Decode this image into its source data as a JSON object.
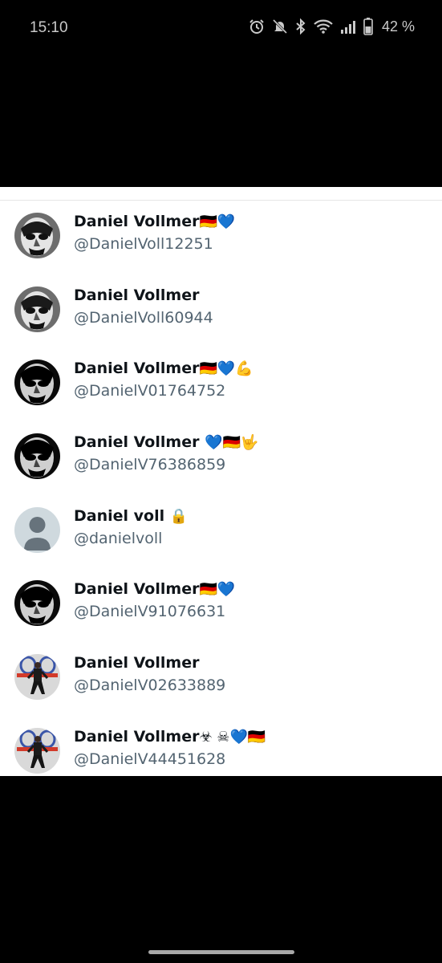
{
  "status_bar": {
    "time": "15:10",
    "battery": "42 %",
    "icons": [
      "alarm-icon",
      "mute-icon",
      "bluetooth-icon",
      "wifi-icon",
      "signal-icon",
      "battery-icon"
    ]
  },
  "accounts": [
    {
      "name": "Daniel Vollmer",
      "emoji": "🇩🇪💙",
      "handle": "@DanielVoll12251",
      "avatar": "mask-photo"
    },
    {
      "name": "Daniel Vollmer",
      "emoji": "",
      "handle": "@DanielVoll60944",
      "avatar": "mask-photo"
    },
    {
      "name": "Daniel Vollmer",
      "emoji": "🇩🇪💙💪",
      "handle": "@DanielV01764752",
      "avatar": "mask-photo-dark"
    },
    {
      "name": "Daniel Vollmer ",
      "emoji": "💙🇩🇪🤟",
      "handle": "@DanielV76386859",
      "avatar": "mask-photo-dark"
    },
    {
      "name": "Daniel voll ",
      "emoji": "🔒",
      "handle": "@danielvoll",
      "avatar": "default-avatar"
    },
    {
      "name": "Daniel Vollmer",
      "emoji": "🇩🇪💙",
      "handle": "@DanielV91076631",
      "avatar": "mask-photo-dark"
    },
    {
      "name": "Daniel Vollmer",
      "emoji": "",
      "handle": "@DanielV02633889",
      "avatar": "person-photo"
    },
    {
      "name": "Daniel Vollmer",
      "emoji": "☣ ☠💙🇩🇪",
      "handle": "@DanielV44451628",
      "avatar": "person-photo"
    }
  ],
  "colors": {
    "name_text": "#0f1419",
    "handle_text": "#536471",
    "sheet_background": "#ffffff",
    "screen_background": "#000000"
  }
}
